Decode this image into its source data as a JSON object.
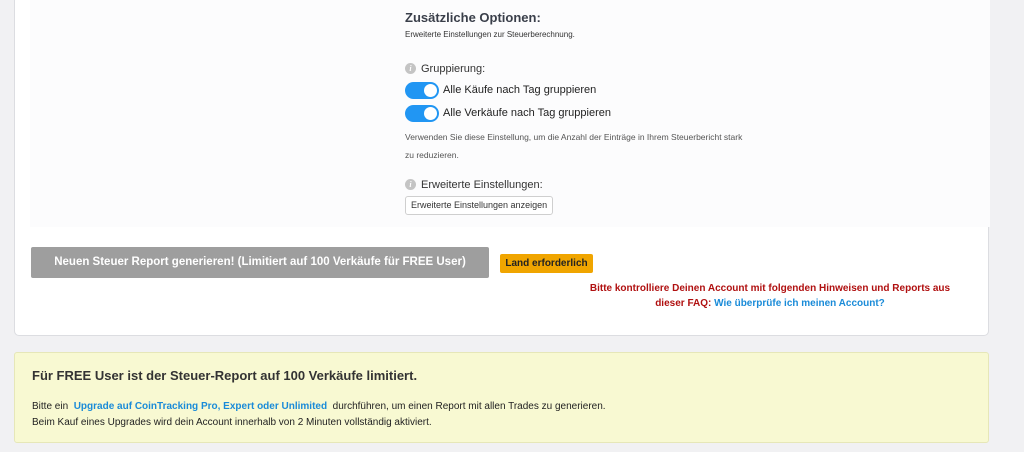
{
  "options": {
    "title": "Zusätzliche Optionen:",
    "description": "Erweiterte Einstellungen zur Steuerberechnung.",
    "grouping": {
      "label": "Gruppierung:",
      "toggles": [
        {
          "label": "Alle Käufe nach Tag gruppieren",
          "on": true
        },
        {
          "label": "Alle Verkäufe nach Tag gruppieren",
          "on": true
        }
      ],
      "hint_line1": "Verwenden Sie diese Einstellung, um die Anzahl der Einträge in Ihrem Steuerbericht stark",
      "hint_line2": "zu reduzieren."
    },
    "advanced": {
      "label": "Erweiterte Einstellungen:",
      "button": "Erweiterte Einstellungen anzeigen"
    }
  },
  "report": {
    "generate_button": "Neuen Steuer Report generieren! (Limitiert auf 100 Verkäufe für FREE User)",
    "land_badge": "Land erforderlich",
    "warning_line1": "Bitte kontrolliere Deinen Account mit folgenden Hinweisen und Reports aus",
    "warning_line2_prefix": "dieser FAQ:",
    "warning_link": "Wie überprüfe ich meinen Account?"
  },
  "notice": {
    "title": "Für FREE User ist der Steuer-Report auf 100 Verkäufe limitiert.",
    "line1_prefix": "Bitte ein",
    "line1_link": "Upgrade auf CoinTracking Pro, Expert oder Unlimited",
    "line1_suffix": "durchführen, um einen Report mit allen Trades zu generieren.",
    "line2": "Beim Kauf eines Upgrades wird dein Account innerhalb von 2 Minuten vollständig aktiviert."
  },
  "colors": {
    "toggle_on": "#2196f3",
    "badge": "#f0a500",
    "warning": "#b01010",
    "link": "#1a8bd8",
    "notice_bg": "#f8f9d2"
  },
  "icons": {
    "info": "info-icon"
  }
}
